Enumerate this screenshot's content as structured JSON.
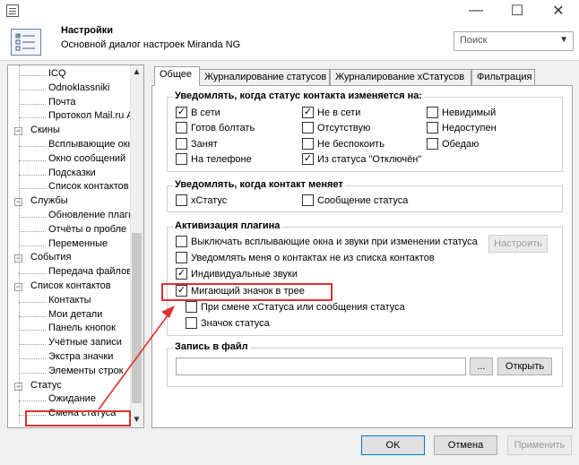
{
  "window": {
    "minimize": "—",
    "maximize": "☐",
    "close": "✕"
  },
  "header": {
    "title": "Настройки",
    "subtitle": "Основной диалог настроек Miranda NG"
  },
  "search": {
    "value": "Поиск"
  },
  "tree": [
    {
      "label": "ICQ",
      "level": 2
    },
    {
      "label": "Odnoklassniki",
      "level": 2
    },
    {
      "label": "Почта",
      "level": 2
    },
    {
      "label": "Протокол Mail.ru А",
      "level": 2
    },
    {
      "label": "Скины",
      "level": 1
    },
    {
      "label": "Всплывающие окн",
      "level": 2
    },
    {
      "label": "Окно сообщений",
      "level": 2
    },
    {
      "label": "Подсказки",
      "level": 2
    },
    {
      "label": "Список контактов",
      "level": 2
    },
    {
      "label": "Службы",
      "level": 1
    },
    {
      "label": "Обновление плаги",
      "level": 2
    },
    {
      "label": "Отчёты о пробле",
      "level": 2
    },
    {
      "label": "Переменные",
      "level": 2
    },
    {
      "label": "События",
      "level": 1
    },
    {
      "label": "Передача файлов",
      "level": 2
    },
    {
      "label": "Список контактов",
      "level": 1
    },
    {
      "label": "Контакты",
      "level": 2
    },
    {
      "label": "Мои детали",
      "level": 2
    },
    {
      "label": "Панель кнопок",
      "level": 2
    },
    {
      "label": "Учётные записи",
      "level": 2
    },
    {
      "label": "Экстра значки",
      "level": 2
    },
    {
      "label": "Элементы строк",
      "level": 2
    },
    {
      "label": "Статус",
      "level": 1
    },
    {
      "label": "Ожидание",
      "level": 2
    },
    {
      "label": "Смена статуса",
      "level": 2
    }
  ],
  "tabs": [
    "Общее",
    "Журналирование статусов",
    "Журналирование xСтатусов",
    "Фильтрация"
  ],
  "group_notify": {
    "title": "Уведомлять, когда статус контакта изменяется на:",
    "items": [
      {
        "label": "В сети",
        "checked": true
      },
      {
        "label": "Не в сети",
        "checked": true
      },
      {
        "label": "Невидимый",
        "checked": false
      },
      {
        "label": "Готов болтать",
        "checked": false
      },
      {
        "label": "Отсутствую",
        "checked": false
      },
      {
        "label": "Недоступен",
        "checked": false
      },
      {
        "label": "Занят",
        "checked": false
      },
      {
        "label": "Не беспокоить",
        "checked": false
      },
      {
        "label": "Обедаю",
        "checked": false
      },
      {
        "label": "На телефоне",
        "checked": false
      },
      {
        "label": "Из статуса \"Отключён\"",
        "checked": true
      }
    ]
  },
  "group_contact": {
    "title": "Уведомлять, когда контакт меняет",
    "items": [
      {
        "label": "xСтатус",
        "checked": false
      },
      {
        "label": "Сообщение статуса",
        "checked": false
      }
    ]
  },
  "group_plugin": {
    "title": "Активизация плагина",
    "items": [
      {
        "label": "Выключать всплывающие окна и звуки при изменении статуса",
        "checked": false
      },
      {
        "label": "Уведомлять меня о контактах не из списка контактов",
        "checked": false
      },
      {
        "label": "Индивидуальные звуки",
        "checked": true
      },
      {
        "label": "Мигающий значок в трее",
        "checked": true
      },
      {
        "label": "При смене xСтатуса или сообщения статуса",
        "checked": false
      },
      {
        "label": "Значок статуса",
        "checked": false
      }
    ],
    "configure_button": "Настроить"
  },
  "group_log": {
    "title": "Запись в файл",
    "path_value": "",
    "browse_button": "...",
    "open_button": "Открыть"
  },
  "footer": {
    "ok": "OK",
    "cancel": "Отмена",
    "apply": "Применить"
  },
  "colors": {
    "highlight": "#e03030",
    "focus": "#0078d7"
  }
}
